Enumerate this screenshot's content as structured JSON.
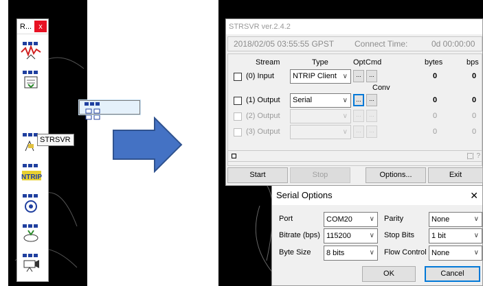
{
  "launcher": {
    "title": "R...",
    "close": "x",
    "tooltip": "STRSVR",
    "icons": [
      "rtkplot-icon",
      "rtkconv-icon",
      "strsvr-icon",
      "rtkpost-icon",
      "ntrip-browser-icon",
      "rtknavi-icon",
      "rtkget-icon",
      "rtkvideo-icon"
    ],
    "ntrip_text": "NTRIP"
  },
  "strsvr": {
    "title": "STRSVR ver.2.4.2",
    "time": "2018/02/05 03:55:55 GPST",
    "connect_label": "Connect Time:",
    "connect_value": "0d 00:00:00",
    "headers": {
      "stream": "Stream",
      "type": "Type",
      "opt": "Opt",
      "cmd": "Cmd",
      "bytes": "bytes",
      "bps": "bps",
      "conv": "Conv"
    },
    "rows": [
      {
        "label": "(0) Input",
        "type": "NTRIP Client",
        "opt": "...",
        "cmd": "...",
        "bytes": "0",
        "bps": "0"
      },
      {
        "label": "(1) Output",
        "type": "Serial",
        "opt": "...",
        "cmd": "...",
        "bytes": "0",
        "bps": "0"
      },
      {
        "label": "(2) Output",
        "type": "",
        "opt": "...",
        "cmd": "...",
        "bytes": "0",
        "bps": "0"
      },
      {
        "label": "(3) Output",
        "type": "",
        "opt": "...",
        "cmd": "...",
        "bytes": "0",
        "bps": "0"
      }
    ],
    "help": "?",
    "buttons": {
      "start": "Start",
      "stop": "Stop",
      "options": "Options...",
      "exit": "Exit"
    }
  },
  "serial": {
    "title": "Serial Options",
    "close": "✕",
    "port_label": "Port",
    "port": "COM20",
    "bitrate_label": "Bitrate (bps)",
    "bitrate": "115200",
    "bytesize_label": "Byte Size",
    "bytesize": "8 bits",
    "parity_label": "Parity",
    "parity": "None",
    "stopbits_label": "Stop Bits",
    "stopbits": "1 bit",
    "flow_label": "Flow Control",
    "flow": "None",
    "ok": "OK",
    "cancel": "Cancel"
  },
  "colors": {
    "arrow": "#4472c4",
    "focus": "#0078d7",
    "close_red": "#e81123"
  }
}
